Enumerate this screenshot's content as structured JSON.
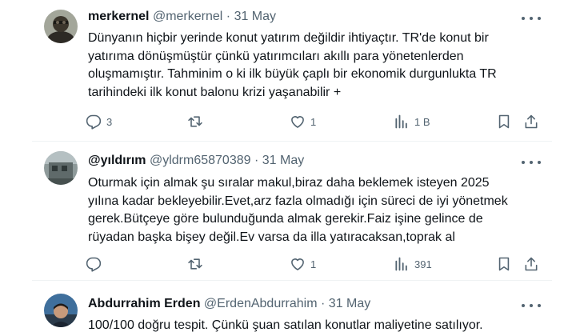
{
  "tweets": [
    {
      "display_name": "merkernel",
      "handle": "@merkernel",
      "dot": "·",
      "date": "31 May",
      "lines": [
        "Dünyanın hiçbir yerinde konut yatırım değildir ihtiyaçtır. TR'de konut bir",
        "yatırıma dönüşmüştür çünkü yatırımcıları akıllı para yönetenlerden",
        "oluşmamıştır. Tahminim o ki ilk büyük çaplı bir ekonomik durgunlukta TR",
        "tarihindeki ilk konut balonu krizi yaşanabilir +"
      ],
      "replies": "3",
      "retweets": "",
      "likes": "1",
      "views": "1 B"
    },
    {
      "display_name": "@yıldırım",
      "handle": "@yldrm65870389",
      "dot": "·",
      "date": "31 May",
      "lines": [
        "Oturmak için almak şu sıralar makul,biraz daha beklemek isteyen 2025",
        "yılına kadar bekleyebilir.Evet,arz fazla olmadığı için süreci de iyi yönetmek",
        "gerek.Bütçeye göre bulunduğunda almak gerekir.Faiz işine gelince de",
        "rüyadan başka bişey değil.Ev varsa da illa yatıracaksan,toprak al"
      ],
      "replies": "",
      "retweets": "",
      "likes": "1",
      "views": "391"
    },
    {
      "display_name": "Abdurrahim Erden",
      "handle": "@ErdenAbdurrahim",
      "dot": "·",
      "date": "31 May",
      "lines": [
        "100/100 doğru tespit. Çünkü şuan satılan konutlar maliyetine satılıyor."
      ]
    }
  ],
  "icons": {
    "more": "more-dots-icon",
    "reply": "reply-icon",
    "retweet": "retweet-icon",
    "like": "heart-icon",
    "views": "views-icon",
    "bookmark": "bookmark-icon",
    "share": "share-icon"
  },
  "colors": {
    "text": "#0f1419",
    "muted": "#536471",
    "separator": "#eff3f4"
  }
}
